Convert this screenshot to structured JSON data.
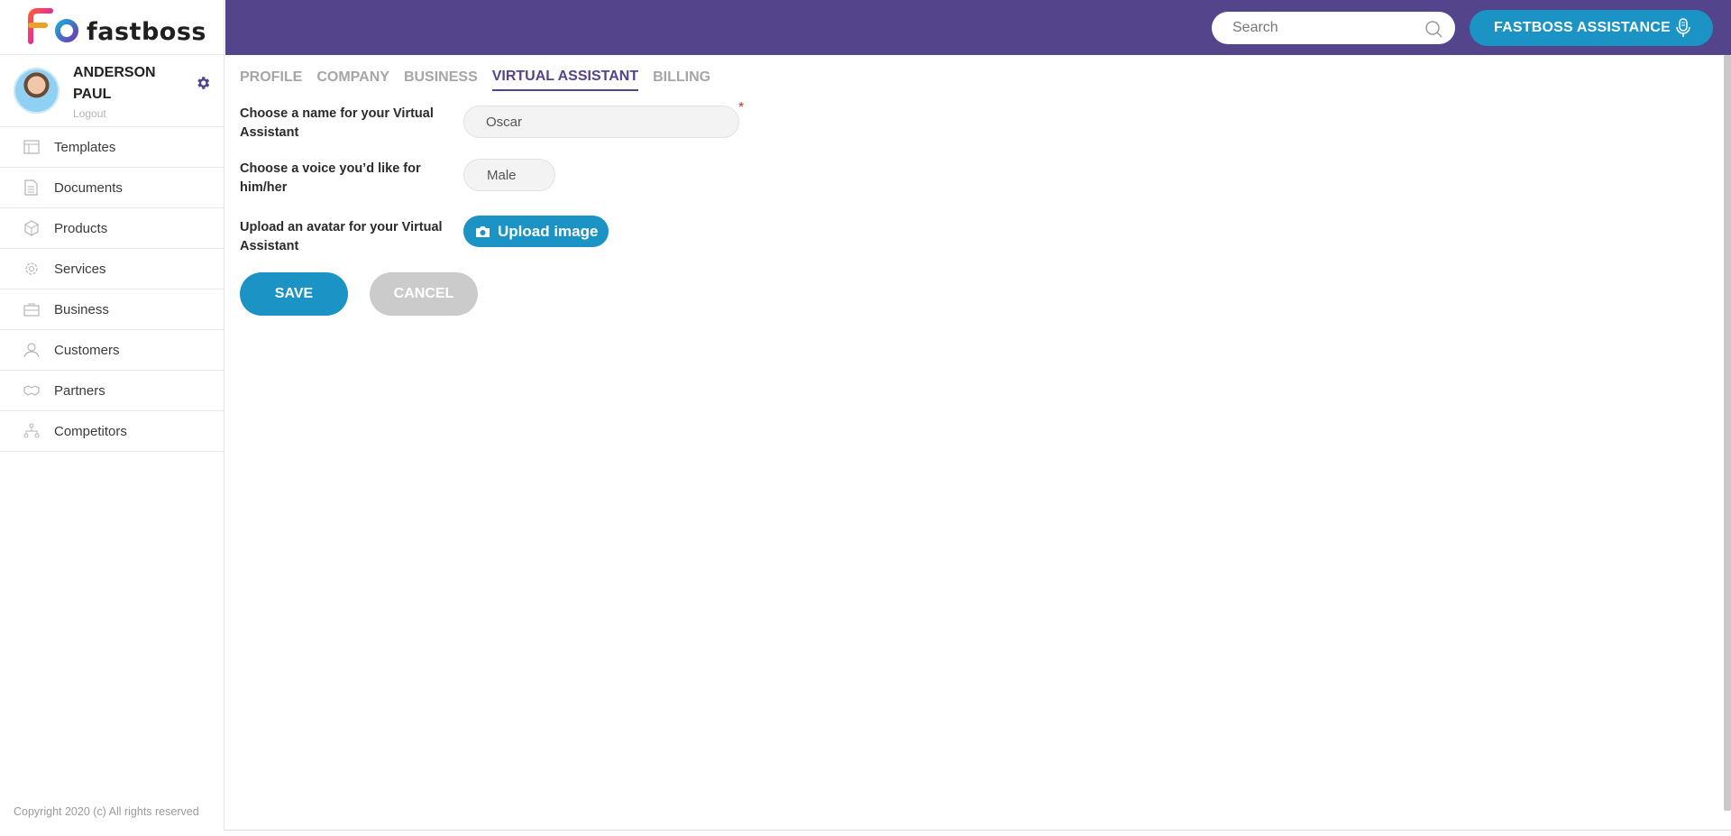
{
  "brand": {
    "logo_text": "fastboss",
    "logo_letters": "Fb"
  },
  "user": {
    "name_line1": "ANDERSON",
    "name_line2": "PAUL",
    "logout": "Logout"
  },
  "sidebar": {
    "items": [
      {
        "label": "Templates",
        "icon": "templates-icon"
      },
      {
        "label": "Documents",
        "icon": "document-icon"
      },
      {
        "label": "Products",
        "icon": "box-icon"
      },
      {
        "label": "Services",
        "icon": "gear-outline-icon"
      },
      {
        "label": "Business",
        "icon": "briefcase-icon"
      },
      {
        "label": "Customers",
        "icon": "person-icon"
      },
      {
        "label": "Partners",
        "icon": "handshake-icon"
      },
      {
        "label": "Competitors",
        "icon": "org-chart-icon"
      }
    ],
    "copyright": "Copyright 2020 (c) All rights reserved"
  },
  "header": {
    "search_placeholder": "Search",
    "assistant_button": "FASTBOSS ASSISTANCE"
  },
  "tabs": [
    "PROFILE",
    "COMPANY",
    "BUSINESS",
    "VIRTUAL ASSISTANT",
    "BILLING"
  ],
  "active_tab": "VIRTUAL ASSISTANT",
  "form": {
    "name_label": "Choose a name for your Virtual Assistant",
    "name_value": "Oscar",
    "required_mark": "*",
    "voice_label": "Choose a voice you’d like for him/her",
    "voice_value": "Male",
    "avatar_label": "Upload an avatar for your Virtual Assistant",
    "upload_button": "Upload image",
    "save_button": "SAVE",
    "cancel_button": "CANCEL"
  },
  "colors": {
    "brand_purple": "#53448c",
    "accent_blue": "#1b93c4",
    "cancel_gray": "#cbcbcb",
    "required_red": "#c0392b"
  }
}
